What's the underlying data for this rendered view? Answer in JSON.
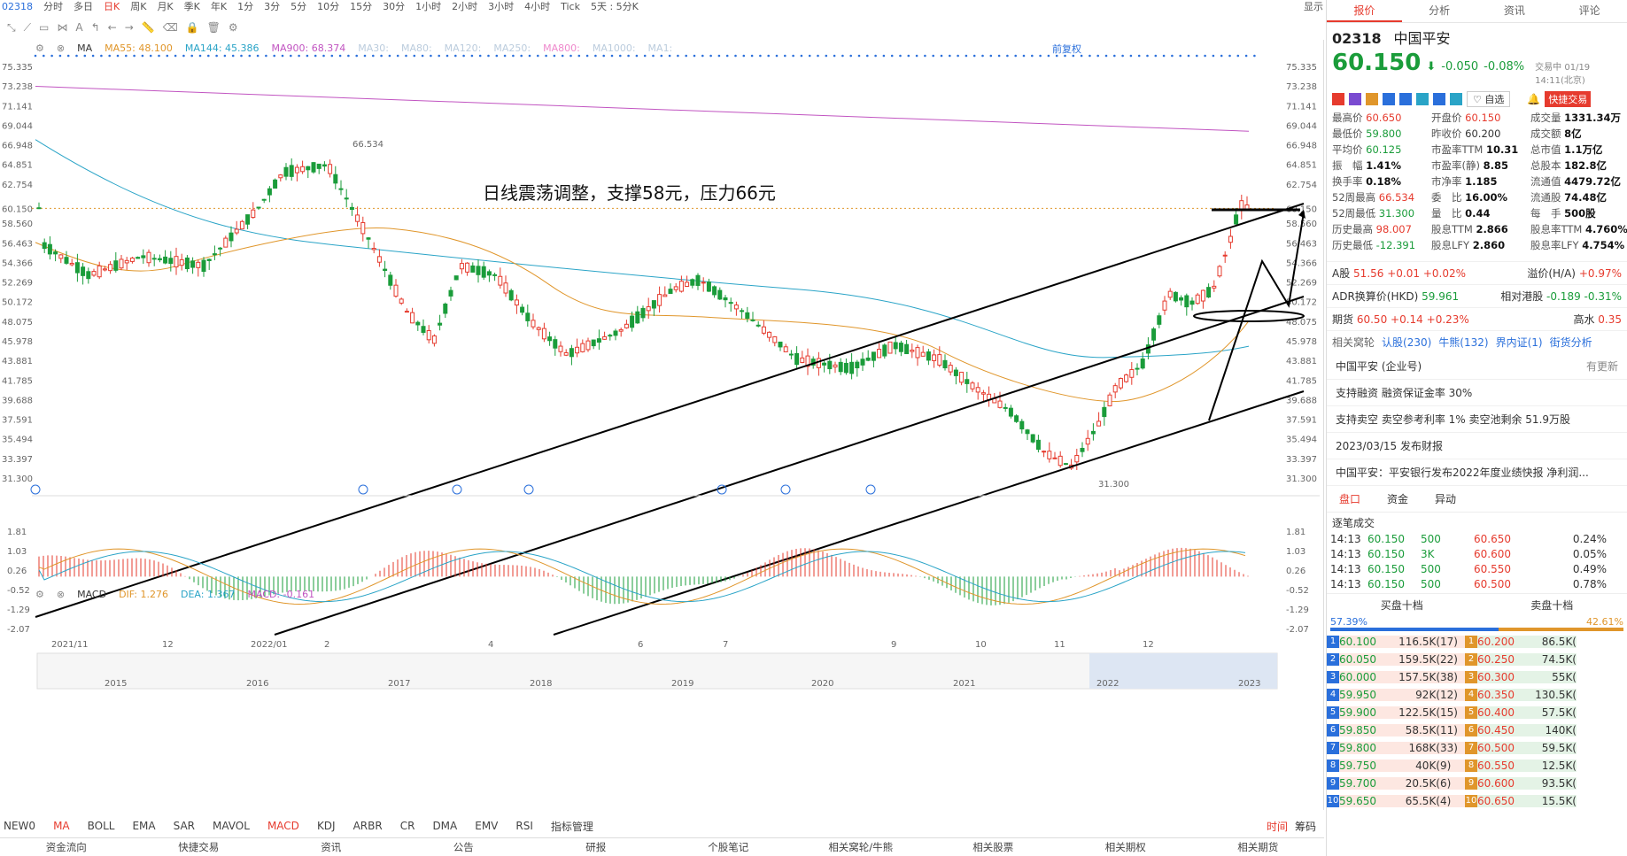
{
  "topbar": {
    "code": "02318",
    "periods": [
      "分时",
      "多日",
      "日K",
      "周K",
      "月K",
      "季K",
      "年K",
      "1分",
      "3分",
      "5分",
      "10分",
      "15分",
      "30分",
      "1小时",
      "2小时",
      "3小时",
      "4小时",
      "Tick",
      "5天 : 5分K"
    ],
    "active": "日K",
    "right": [
      "显示"
    ]
  },
  "ma_legend": {
    "label": "MA",
    "items": [
      {
        "name": "MA55:",
        "value": "48.100",
        "color": "#e0962b"
      },
      {
        "name": "MA144:",
        "value": "45.386",
        "color": "#2aa4c7"
      },
      {
        "name": "MA900:",
        "value": "68.374",
        "color": "#c154c1"
      },
      {
        "name": "MA30:",
        "value": "",
        "color": "#bcd"
      },
      {
        "name": "MA80:",
        "value": "",
        "color": "#bcd"
      },
      {
        "name": "MA120:",
        "value": "",
        "color": "#bcd"
      },
      {
        "name": "MA250:",
        "value": "",
        "color": "#bcd"
      },
      {
        "name": "MA800:",
        "value": "",
        "color": "#e8c"
      },
      {
        "name": "MA1000:",
        "value": "",
        "color": "#bcd"
      },
      {
        "name": "MA1:",
        "value": "",
        "color": "#bcd"
      }
    ],
    "adjust": "前复权"
  },
  "annotation": "日线震荡调整，支撑58元，压力66元",
  "price_axis": [
    "75.335",
    "73.238",
    "71.141",
    "69.044",
    "66.948",
    "64.851",
    "62.754",
    "60.150",
    "58.560",
    "56.463",
    "54.366",
    "52.269",
    "50.172",
    "48.075",
    "45.978",
    "43.881",
    "41.785",
    "39.688",
    "37.591",
    "35.494",
    "33.397",
    "31.300"
  ],
  "high_label": "66.534",
  "low_label": "31.300",
  "macd_legend": {
    "label": "MACD",
    "dif_label": "DIF:",
    "dif": "1.276",
    "dea_label": "DEA:",
    "dea": "1.367",
    "macd_label": "MACD:",
    "macd": "-0.161"
  },
  "macd_axis": [
    "1.81",
    "1.03",
    "0.26",
    "-0.52",
    "-1.29",
    "-2.07"
  ],
  "time_axis": [
    "2021/11",
    "12",
    "2022/01",
    "2",
    "4",
    "6",
    "7",
    "9",
    "10",
    "11",
    "12"
  ],
  "overview_years": [
    "2015",
    "2016",
    "2017",
    "2018",
    "2019",
    "2020",
    "2021",
    "2022",
    "2023"
  ],
  "indicator_tabs": [
    "NEW0",
    "MA",
    "BOLL",
    "EMA",
    "SAR",
    "MAVOL",
    "MACD",
    "KDJ",
    "ARBR",
    "CR",
    "DMA",
    "EMV",
    "RSI",
    "指标管理"
  ],
  "indicator_active": [
    "MA",
    "MACD"
  ],
  "right_tabs": [
    "时间",
    "筹码"
  ],
  "footer": [
    "资金流向",
    "快捷交易",
    "资讯",
    "公告",
    "研报",
    "个股笔记",
    "相关窝轮/牛熊",
    "相关股票",
    "相关期权",
    "相关期货"
  ],
  "panel": {
    "tabs": [
      "报价",
      "分析",
      "资讯",
      "评论"
    ],
    "code": "02318",
    "name": "中国平安",
    "price": "60.150",
    "change": "-0.050",
    "pct": "-0.08%",
    "time": "交易中 01/19 14:11(北京)",
    "watch": "自选",
    "quick": "快捷交易",
    "stats": [
      [
        "最高价",
        "60.650",
        "red",
        "开盘价",
        "60.150",
        "red",
        "成交量",
        "1331.34万",
        "blk"
      ],
      [
        "最低价",
        "59.800",
        "green",
        "昨收价",
        "60.200",
        "",
        "成交额",
        "8亿",
        "blk"
      ],
      [
        "平均价",
        "60.125",
        "green",
        "市盈率TTM",
        "10.31",
        "blk",
        "总市值",
        "1.1万亿",
        "blk"
      ],
      [
        "振　幅",
        "1.41%",
        "blk",
        "市盈率(静)",
        "8.85",
        "blk",
        "总股本",
        "182.8亿",
        "blk"
      ],
      [
        "换手率",
        "0.18%",
        "blk",
        "市净率",
        "1.185",
        "blk",
        "流通值",
        "4479.72亿",
        "blk"
      ],
      [
        "52周最高",
        "66.534",
        "red",
        "委　比",
        "16.00%",
        "blk",
        "流通股",
        "74.48亿",
        "blk"
      ],
      [
        "52周最低",
        "31.300",
        "green",
        "量　比",
        "0.44",
        "blk",
        "每　手",
        "500股",
        "blk"
      ],
      [
        "历史最高",
        "98.007",
        "red",
        "股息TTM",
        "2.866",
        "blk",
        "股息率TTM",
        "4.760%",
        "blk"
      ],
      [
        "历史最低",
        "-12.391",
        "green",
        "股息LFY",
        "2.860",
        "blk",
        "股息率LFY",
        "4.754%",
        "blk"
      ]
    ],
    "a_share": {
      "label": "A股",
      "price": "51.56",
      "chg": "+0.01",
      "pct": "+0.02%",
      "premium_label": "溢价(H/A)",
      "premium": "+0.97%"
    },
    "adr": {
      "label": "ADR换算价(HKD)",
      "price": "59.961",
      "rel_label": "相对港股",
      "chg": "-0.189",
      "pct": "-0.31%"
    },
    "futures": {
      "label": "期货",
      "price": "60.50",
      "chg": "+0.14",
      "pct": "+0.23%",
      "extra": "高水",
      "extra_val": "0.35"
    },
    "warrants": {
      "label": "相关窝轮",
      "items": [
        "认股(230)",
        "牛熊(132)",
        "界内证(1)",
        "街货分析"
      ]
    },
    "news": [
      {
        "text": "中国平安 (企业号)",
        "right": "有更新"
      },
      {
        "text": "支持融资 融资保证金率 30%",
        "right": ""
      },
      {
        "text": "支持卖空 卖空参考利率 1% 卖空池剩余 51.9万股",
        "right": ""
      },
      {
        "text": "2023/03/15 发布财报",
        "right": ""
      },
      {
        "text": "中国平安：平安银行发布2022年度业绩快报 净利润...",
        "right": ""
      }
    ],
    "subtabs": [
      "盘口",
      "资金",
      "异动"
    ],
    "ticks_title": "逐笔成交",
    "ticks": [
      [
        "14:13",
        "60.150",
        "500"
      ],
      [
        "14:13",
        "60.150",
        "3K"
      ],
      [
        "14:13",
        "60.150",
        "500"
      ],
      [
        "14:13",
        "60.150",
        "500"
      ]
    ],
    "tick_levels": [
      [
        "60.650",
        "0.24%"
      ],
      [
        "60.600",
        "0.05%"
      ],
      [
        "60.550",
        "0.49%"
      ],
      [
        "60.500",
        "0.78%"
      ]
    ],
    "depth_titles": [
      "买盘十档",
      "卖盘十档"
    ],
    "bid_pct": "57.39%",
    "ask_pct": "42.61%",
    "book": [
      [
        "1",
        "60.100",
        "116.5K(",
        "17)",
        "1",
        "60.200",
        "86.5K("
      ],
      [
        "2",
        "60.050",
        "159.5K(",
        "22)",
        "2",
        "60.250",
        "74.5K("
      ],
      [
        "3",
        "60.000",
        "157.5K(",
        "38)",
        "3",
        "60.300",
        "55K("
      ],
      [
        "4",
        "59.950",
        "92K(",
        "12)",
        "4",
        "60.350",
        "130.5K("
      ],
      [
        "5",
        "59.900",
        "122.5K(",
        "15)",
        "5",
        "60.400",
        "57.5K("
      ],
      [
        "6",
        "59.850",
        "58.5K(",
        "11)",
        "6",
        "60.450",
        "140K("
      ],
      [
        "7",
        "59.800",
        "168K(",
        "33)",
        "7",
        "60.500",
        "59.5K("
      ],
      [
        "8",
        "59.750",
        "40K(",
        "9)",
        "8",
        "60.550",
        "12.5K("
      ],
      [
        "9",
        "59.700",
        "20.5K(",
        "6)",
        "9",
        "60.600",
        "93.5K("
      ],
      [
        "10",
        "59.650",
        "65.5K(",
        "4)",
        "10",
        "60.650",
        "15.5K("
      ]
    ]
  }
}
